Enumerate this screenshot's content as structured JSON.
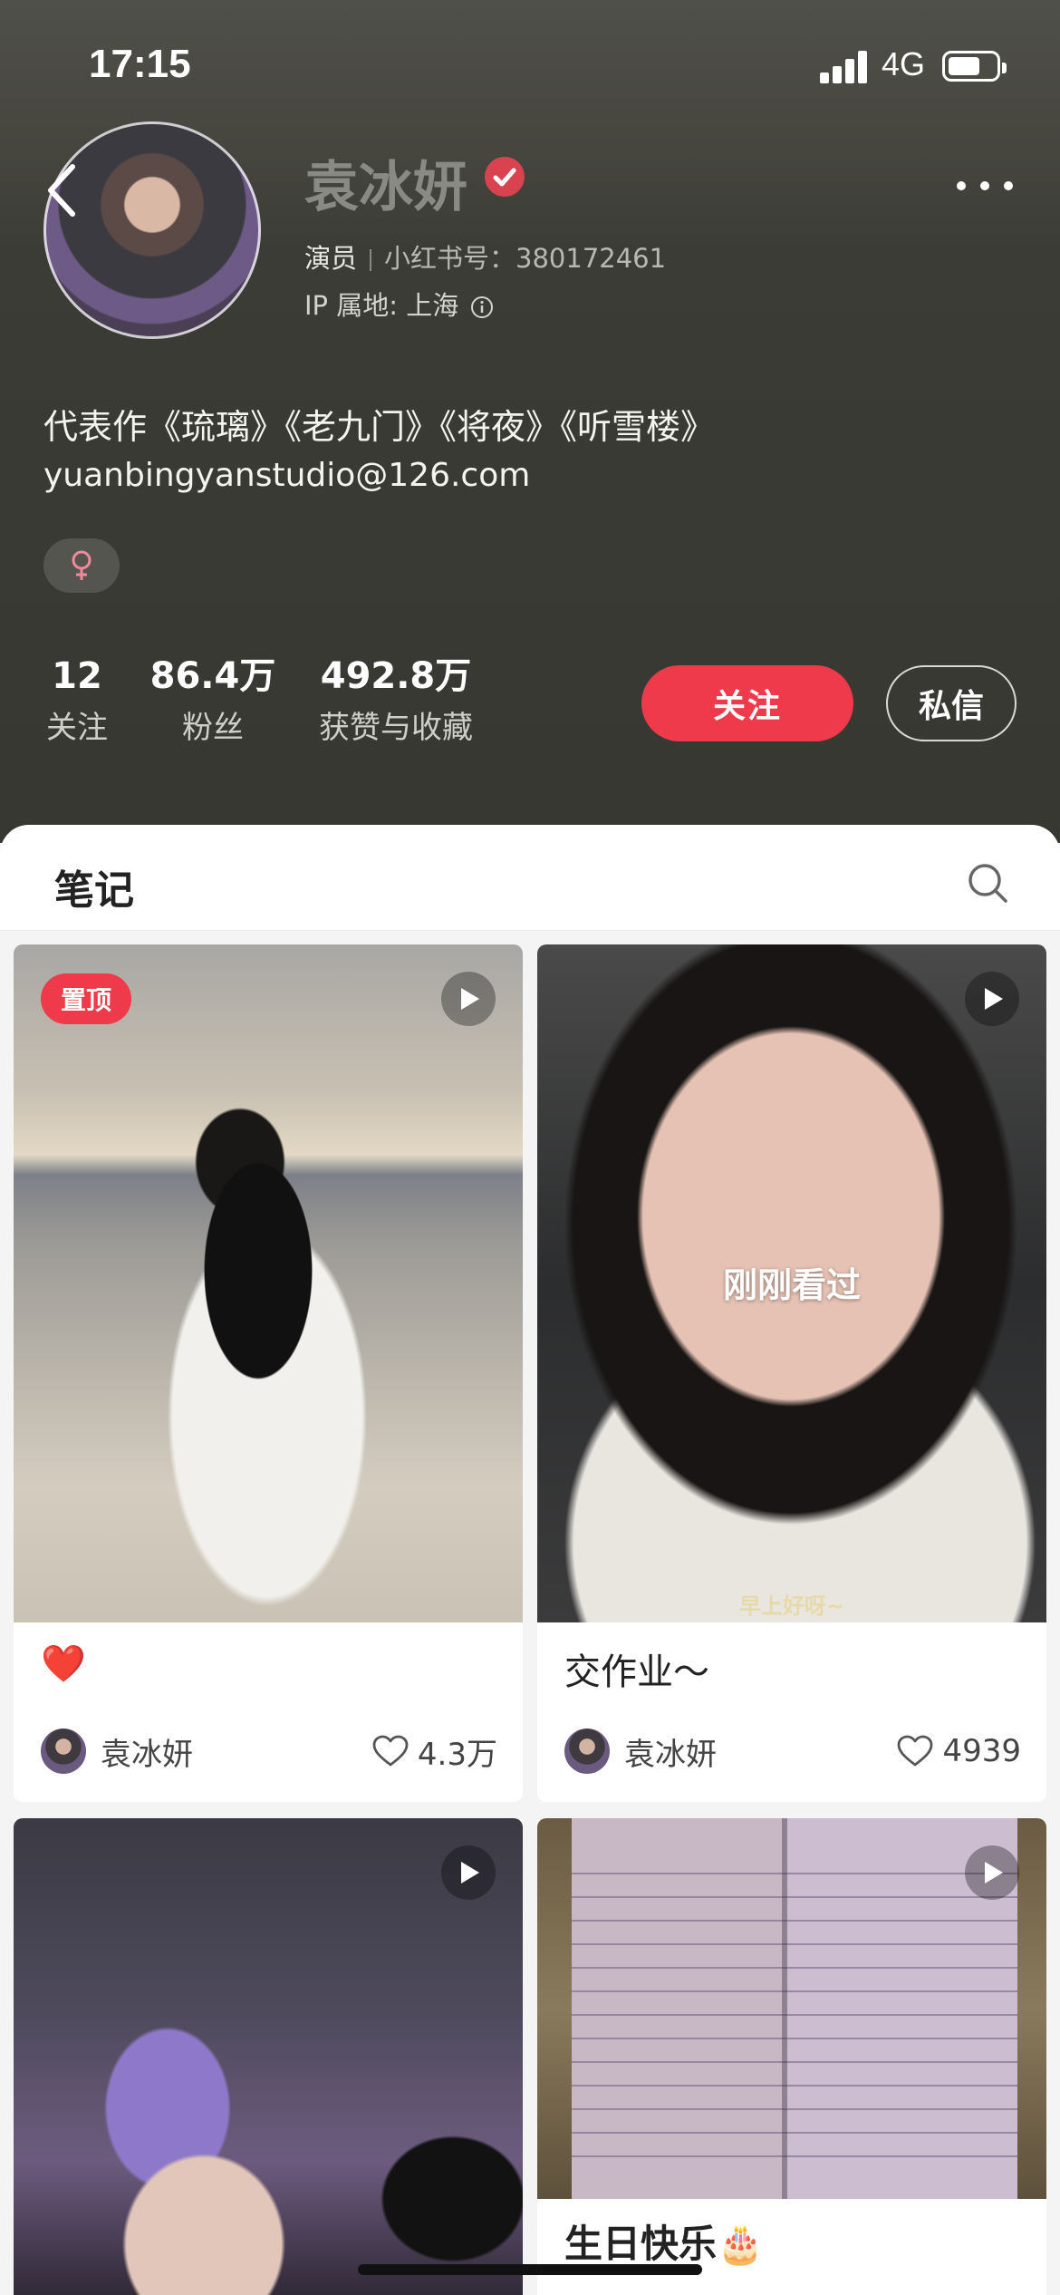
{
  "status_bar": {
    "time": "17:15",
    "network": "4G"
  },
  "profile": {
    "name": "袁冰妍",
    "role": "演员",
    "xhs_id_label": "小红书号：",
    "xhs_id": "380172461",
    "ip_label": "IP 属地: 上海",
    "bio_line1": "代表作《琉璃》《老九门》《将夜》《听雪楼》",
    "bio_line2": "yuanbingyanstudio@126.com",
    "gender_symbol": "♀"
  },
  "stats": [
    {
      "value": "12",
      "label": "关注"
    },
    {
      "value": "86.4万",
      "label": "粉丝"
    },
    {
      "value": "492.8万",
      "label": "获赞与收藏"
    }
  ],
  "actions": {
    "follow": "关注",
    "message": "私信"
  },
  "tabs": {
    "notes": "笔记"
  },
  "notes": [
    {
      "badge": "置顶",
      "title": "❤️",
      "author": "袁冰妍",
      "likes": "4.3万",
      "video": true
    },
    {
      "overlay": "刚刚看过",
      "subtitle": "早上好呀~",
      "title": "交作业～",
      "author": "袁冰妍",
      "likes": "4939",
      "video": true
    },
    {
      "title": "",
      "video": true
    },
    {
      "title": "生日快乐🎂",
      "video": true
    }
  ],
  "colors": {
    "accent": "#ee3a4a",
    "header_bg": "#3b3b35"
  }
}
